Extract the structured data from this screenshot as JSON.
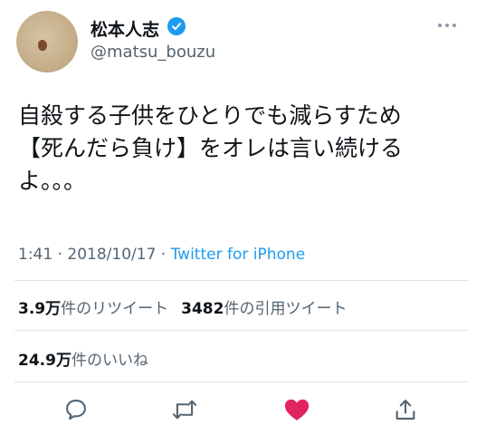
{
  "user": {
    "display_name": "松本人志",
    "handle": "@matsu_bouzu",
    "verified": true
  },
  "tweet": {
    "text": "自殺する子供をひとりでも減らすため\n【死んだら負け】をオレは言い続ける\nよ。。。",
    "time": "1:41",
    "date": "2018/10/17",
    "separator": "·",
    "source": "Twitter for iPhone"
  },
  "stats": {
    "retweets_value": "3.9万",
    "retweets_label": "件のリツイート",
    "quotes_value": "3482",
    "quotes_label": "件の引用ツイート",
    "likes_value": "24.9万",
    "likes_label": "件のいいね"
  },
  "actions": {
    "icons": [
      "reply-icon",
      "retweet-icon",
      "like-icon",
      "share-icon"
    ],
    "like_color": "#e0245e",
    "icon_color": "#536471"
  },
  "colors": {
    "accent": "#1d9bf0",
    "text": "#0f1419",
    "secondary": "#536471"
  }
}
